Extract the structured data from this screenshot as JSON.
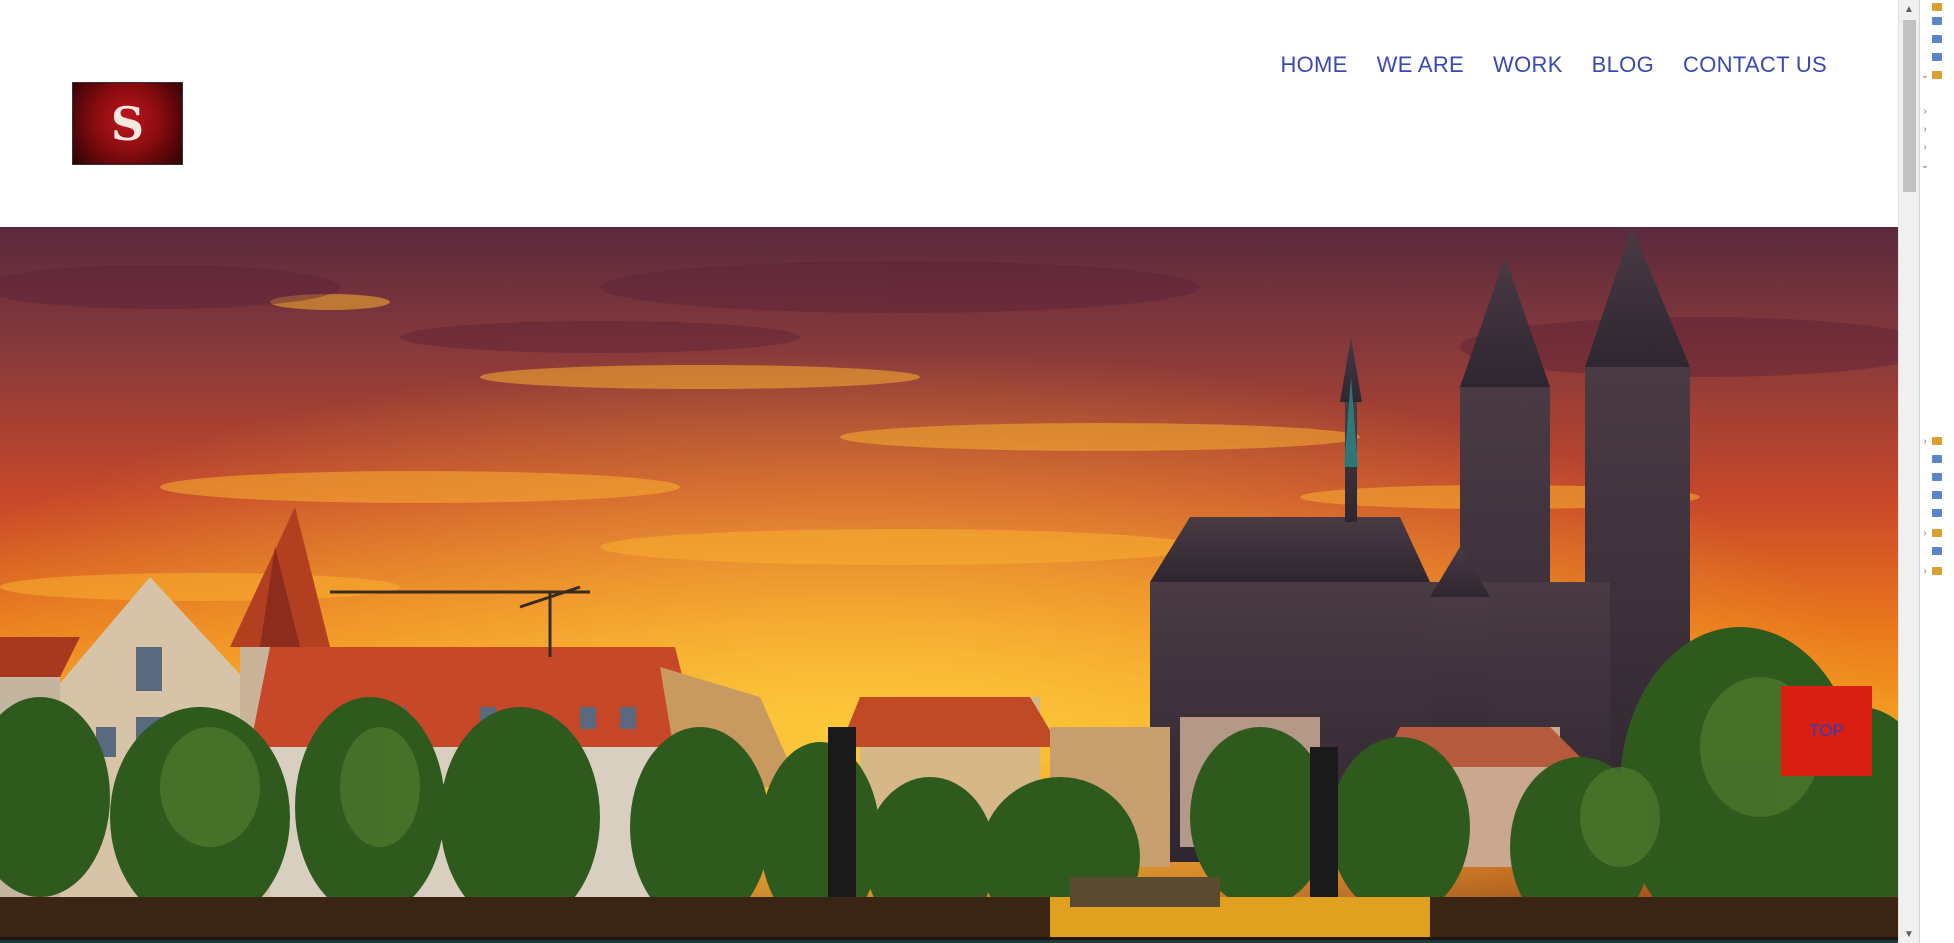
{
  "logo": {
    "letter": "S"
  },
  "nav": {
    "items": [
      {
        "label": "HOME"
      },
      {
        "label": "WE ARE"
      },
      {
        "label": "WORK"
      },
      {
        "label": "BLOG"
      },
      {
        "label": "CONTACT US"
      }
    ]
  },
  "top_button": {
    "label": "TOP"
  },
  "colors": {
    "nav_text": "#3b48b4",
    "top_button_bg": "#d81f12",
    "top_button_text": "#2a3fc0"
  }
}
